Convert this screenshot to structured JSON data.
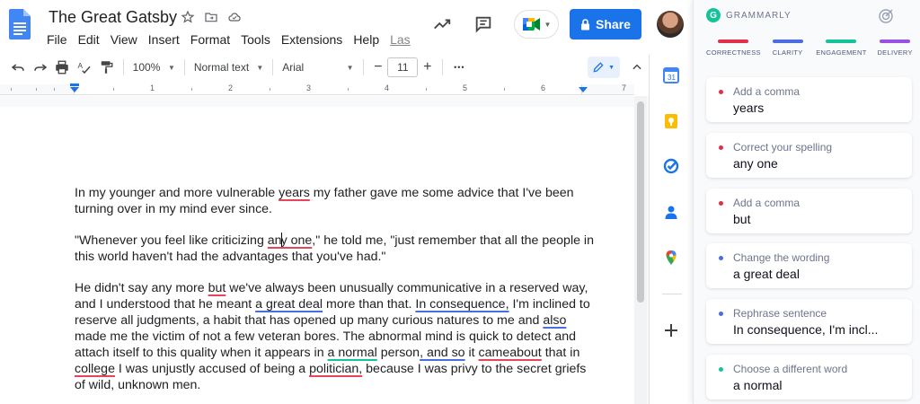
{
  "app": {
    "doc_title": "The Great Gatsby",
    "menus": [
      "File",
      "Edit",
      "View",
      "Insert",
      "Format",
      "Tools",
      "Extensions",
      "Help"
    ],
    "last_edit_link": "Las",
    "share_label": "Share"
  },
  "toolbar": {
    "zoom": "100%",
    "style": "Normal text",
    "font": "Arial",
    "font_size": "11",
    "minus": "−",
    "plus": "+",
    "more": "•••"
  },
  "ruler": {
    "numbers": [
      "1",
      "2",
      "3",
      "4",
      "5",
      "6",
      "7"
    ]
  },
  "document": {
    "p1": {
      "a": "In my younger and more vulnerable ",
      "b": "years",
      "c": " my father gave me some advice that I've been turning over in my mind ever since."
    },
    "p2": {
      "a": "\"Whenever you feel like criticizing ",
      "b1": "an",
      "b2": "y one",
      "c": ",\" he told me, \"just remember that all the people in this world haven't had the advantages that you've had.\""
    },
    "p3": {
      "s1": "He didn't say any more ",
      "s2": "but",
      "s3": " we've always been unusually communicative in a reserved way, and I understood that he meant ",
      "s4": "a great deal",
      "s5": " more than that. ",
      "s6": "In consequence,",
      "s7": " I'm inclined to reserve all judgments, a habit that has opened up many curious natures to me and ",
      "s8": "also",
      "s9": " made me the victim of not a few veteran bores. The abnormal mind is quick to detect and attach itself to this quality when it appears in ",
      "s10": "a normal",
      "s11": " person",
      "s12": ", and so",
      "s13": " it ",
      "s14": "cameabout",
      "s15": " that in ",
      "s16": "college",
      "s17": " I was unjustly accused of being a ",
      "s18": "politician,",
      "s19": " because I was privy to the secret griefs of wild, unknown men."
    }
  },
  "grammarly": {
    "brand": "GRAMMARLY",
    "categories": [
      {
        "label": "CORRECTNESS",
        "color": "#e0304a"
      },
      {
        "label": "CLARITY",
        "color": "#4a6ee0"
      },
      {
        "label": "ENGAGEMENT",
        "color": "#15c39a"
      },
      {
        "label": "DELIVERY",
        "color": "#9b51e0"
      }
    ],
    "cards": [
      {
        "hint": "Add a comma",
        "text": "years",
        "color": "#e0304a"
      },
      {
        "hint": "Correct your spelling",
        "text": "any one",
        "color": "#e0304a"
      },
      {
        "hint": "Add a comma",
        "text": "but",
        "color": "#e0304a"
      },
      {
        "hint": "Change the wording",
        "text": "a great deal",
        "color": "#4a6ee0"
      },
      {
        "hint": "Rephrase sentence",
        "text": "In consequence, I'm incl...",
        "color": "#4a6ee0"
      },
      {
        "hint": "Choose a different word",
        "text": "a normal",
        "color": "#15c39a"
      }
    ]
  }
}
